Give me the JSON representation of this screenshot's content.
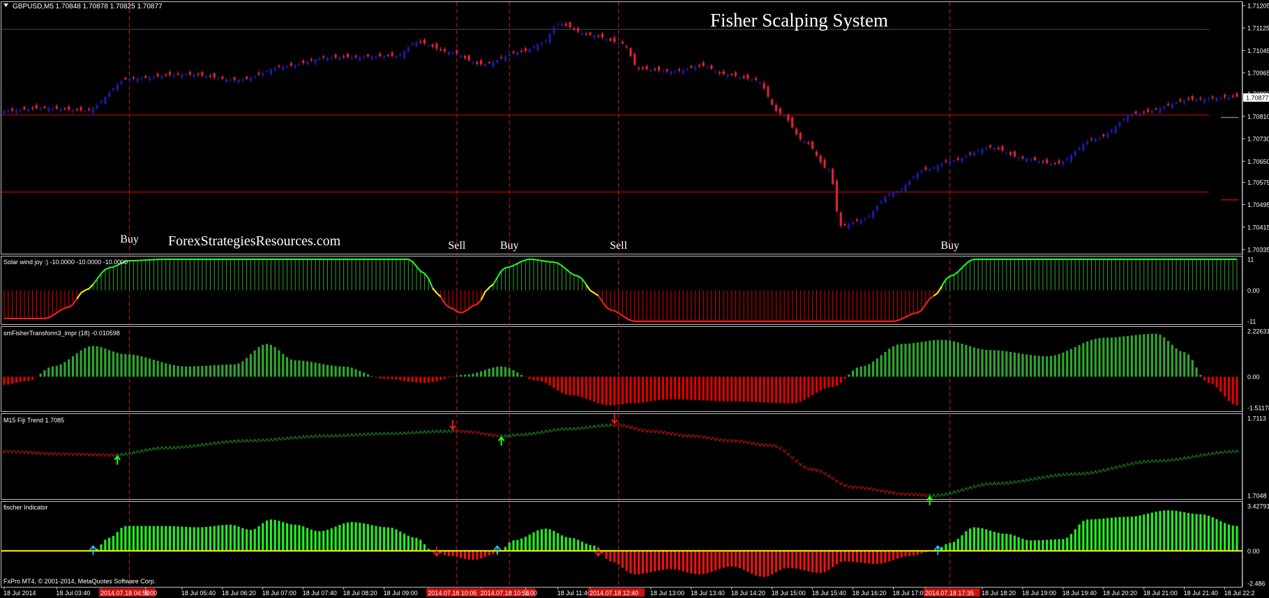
{
  "colors": {
    "bg": "#000000",
    "frame": "#c0c0c0",
    "grid": "#2a2a2a",
    "bull": "#1a1aa6",
    "bear": "#e0203a",
    "level": "#c00000",
    "vline": "#d01818",
    "green": "#2fa52f",
    "bright_green": "#22ff22",
    "red": "#e00000",
    "yellow": "#ffff00",
    "cyan": "#19d6ff",
    "text": "#ffffff"
  },
  "header": {
    "symbol_info": "GBPUSD,M5  1.70848 1.70878 1.70825 1.70877",
    "title": "Fisher Scalping System",
    "watermark": "ForexStrategiesResources.com",
    "copyright": "FxPro MT4, © 2001-2014, MetaQuotes Software Corp."
  },
  "signals": [
    {
      "label": "Buy",
      "x_index": 31
    },
    {
      "label": "Sell",
      "x_index": 112
    },
    {
      "label": "Buy",
      "x_index": 125
    },
    {
      "label": "Sell",
      "x_index": 152
    },
    {
      "label": "Buy",
      "x_index": 234
    }
  ],
  "chart_data": [
    {
      "type": "candlestick",
      "title": "GBPUSD,M5",
      "ylim": [
        1.70335,
        1.71205
      ],
      "yticks": [
        "1.71205",
        "1.71125",
        "1.71045",
        "1.70965",
        "1.70890",
        "1.70810",
        "1.70730",
        "1.70650",
        "1.70575",
        "1.70495",
        "1.70415",
        "1.70335"
      ],
      "current_price": "1.70877",
      "levels": [
        1.7112,
        1.70815,
        1.7054
      ],
      "close_anchors": [
        [
          0,
          1.7083
        ],
        [
          10,
          1.7084
        ],
        [
          20,
          1.7083
        ],
        [
          31,
          1.70945
        ],
        [
          45,
          1.7096
        ],
        [
          58,
          1.7094
        ],
        [
          70,
          1.7099
        ],
        [
          80,
          1.7102
        ],
        [
          97,
          1.71025
        ],
        [
          102,
          1.71075
        ],
        [
          110,
          1.7104
        ],
        [
          118,
          1.70995
        ],
        [
          128,
          1.7104
        ],
        [
          133,
          1.7107
        ],
        [
          137,
          1.7114
        ],
        [
          145,
          1.711
        ],
        [
          153,
          1.7107
        ],
        [
          157,
          1.7098
        ],
        [
          165,
          1.7097
        ],
        [
          173,
          1.7099
        ],
        [
          178,
          1.7096
        ],
        [
          186,
          1.7094
        ],
        [
          192,
          1.7082
        ],
        [
          198,
          1.7072
        ],
        [
          204,
          1.7062
        ],
        [
          207,
          1.7042
        ],
        [
          212,
          1.7044
        ],
        [
          220,
          1.7054
        ],
        [
          228,
          1.7062
        ],
        [
          234,
          1.7065
        ],
        [
          244,
          1.707
        ],
        [
          252,
          1.7066
        ],
        [
          260,
          1.7064
        ],
        [
          270,
          1.7073
        ],
        [
          280,
          1.7082
        ],
        [
          294,
          1.7087
        ],
        [
          305,
          1.7088
        ]
      ]
    },
    {
      "type": "bar",
      "title": "Solar wind joy :) -10.0000 -10.0000 -10.0000",
      "ylim": [
        -11,
        11
      ],
      "yticks": [
        "11",
        "0.00",
        "-11"
      ],
      "value_anchors": [
        [
          0,
          -10
        ],
        [
          10,
          -10
        ],
        [
          16,
          -6
        ],
        [
          20,
          0
        ],
        [
          26,
          8
        ],
        [
          31,
          10.5
        ],
        [
          40,
          11
        ],
        [
          100,
          11
        ],
        [
          104,
          6
        ],
        [
          107,
          -1
        ],
        [
          110,
          -6
        ],
        [
          113,
          -8
        ],
        [
          117,
          -5
        ],
        [
          120,
          1
        ],
        [
          124,
          8
        ],
        [
          130,
          11
        ],
        [
          136,
          10
        ],
        [
          142,
          5
        ],
        [
          146,
          -1
        ],
        [
          150,
          -7
        ],
        [
          156,
          -11
        ],
        [
          220,
          -11
        ],
        [
          226,
          -8
        ],
        [
          230,
          -2
        ],
        [
          234,
          5
        ],
        [
          240,
          11
        ],
        [
          305,
          11
        ]
      ]
    },
    {
      "type": "bar",
      "title": "smFisherTransform3_impr (18) -0.010598",
      "ylim": [
        -1.511784,
        2.226317
      ],
      "yticks": [
        "2.226317",
        "0.00",
        "-1.511784"
      ],
      "value_anchors": [
        [
          0,
          -0.4
        ],
        [
          6,
          -0.2
        ],
        [
          12,
          0.5
        ],
        [
          22,
          1.5
        ],
        [
          30,
          1.1
        ],
        [
          45,
          0.5
        ],
        [
          57,
          0.6
        ],
        [
          65,
          1.6
        ],
        [
          72,
          0.8
        ],
        [
          84,
          0.5
        ],
        [
          94,
          -0.1
        ],
        [
          104,
          -0.3
        ],
        [
          114,
          0.1
        ],
        [
          123,
          0.5
        ],
        [
          132,
          -0.2
        ],
        [
          140,
          -0.9
        ],
        [
          150,
          -1.4
        ],
        [
          155,
          -1.3
        ],
        [
          165,
          -1.1
        ],
        [
          180,
          -1.2
        ],
        [
          195,
          -1.3
        ],
        [
          205,
          -0.5
        ],
        [
          212,
          0.5
        ],
        [
          222,
          1.6
        ],
        [
          232,
          1.8
        ],
        [
          244,
          1.3
        ],
        [
          258,
          1.0
        ],
        [
          272,
          1.9
        ],
        [
          285,
          2.1
        ],
        [
          292,
          1.2
        ],
        [
          298,
          -0.3
        ],
        [
          305,
          -1.4
        ]
      ]
    },
    {
      "type": "line",
      "title": "M15 Fiji Trend 1.7085",
      "ylim": [
        1.7048,
        1.7113
      ],
      "yticks": [
        "1.7113",
        "1.7048"
      ],
      "value_anchors": [
        [
          0,
          1.7085
        ],
        [
          14,
          1.7083
        ],
        [
          27,
          1.7082
        ],
        [
          40,
          1.7088
        ],
        [
          60,
          1.7094
        ],
        [
          80,
          1.7098
        ],
        [
          95,
          1.71
        ],
        [
          110,
          1.7102
        ],
        [
          113,
          1.7102
        ],
        [
          124,
          1.7098
        ],
        [
          127,
          1.7099
        ],
        [
          140,
          1.7104
        ],
        [
          150,
          1.7107
        ],
        [
          152,
          1.7107
        ],
        [
          160,
          1.7102
        ],
        [
          170,
          1.7098
        ],
        [
          180,
          1.7094
        ],
        [
          190,
          1.709
        ],
        [
          200,
          1.707
        ],
        [
          210,
          1.7055
        ],
        [
          224,
          1.7049
        ],
        [
          230,
          1.7048
        ],
        [
          245,
          1.7058
        ],
        [
          265,
          1.7066
        ],
        [
          285,
          1.7077
        ],
        [
          305,
          1.7085
        ]
      ],
      "trend_change": [
        [
          0,
          "down"
        ],
        [
          28,
          "up"
        ],
        [
          112,
          "down"
        ],
        [
          123,
          "up"
        ],
        [
          151,
          "down"
        ],
        [
          229,
          "up"
        ]
      ],
      "arrows": [
        {
          "index": 28,
          "dir": "up"
        },
        {
          "index": 111,
          "dir": "down"
        },
        {
          "index": 123,
          "dir": "up"
        },
        {
          "index": 151,
          "dir": "down"
        },
        {
          "index": 229,
          "dir": "up"
        }
      ]
    },
    {
      "type": "bar",
      "title": "fischer Indicator",
      "ylim": [
        -2.486,
        3.42791
      ],
      "yticks": [
        "3.42791",
        "0.00",
        "-2.486"
      ],
      "value_anchors": [
        [
          0,
          0
        ],
        [
          22,
          0
        ],
        [
          26,
          1
        ],
        [
          30,
          1.9
        ],
        [
          40,
          1.9
        ],
        [
          48,
          1.8
        ],
        [
          56,
          2.0
        ],
        [
          61,
          1.6
        ],
        [
          66,
          2.4
        ],
        [
          72,
          2.0
        ],
        [
          78,
          1.5
        ],
        [
          86,
          2.2
        ],
        [
          95,
          1.8
        ],
        [
          102,
          1.0
        ],
        [
          106,
          0
        ],
        [
          110,
          -0.4
        ],
        [
          116,
          -0.7
        ],
        [
          122,
          -0.2
        ],
        [
          126,
          0.8
        ],
        [
          134,
          1.7
        ],
        [
          140,
          1.0
        ],
        [
          146,
          0.4
        ],
        [
          150,
          -0.8
        ],
        [
          156,
          -1.8
        ],
        [
          165,
          -1.4
        ],
        [
          172,
          -1.8
        ],
        [
          180,
          -1.2
        ],
        [
          188,
          -2.0
        ],
        [
          194,
          -1.3
        ],
        [
          202,
          -1.7
        ],
        [
          208,
          -0.8
        ],
        [
          216,
          -1.0
        ],
        [
          224,
          -0.4
        ],
        [
          230,
          0
        ],
        [
          234,
          0.6
        ],
        [
          240,
          1.8
        ],
        [
          248,
          1.3
        ],
        [
          254,
          0.8
        ],
        [
          262,
          0.9
        ],
        [
          268,
          2.4
        ],
        [
          278,
          2.6
        ],
        [
          288,
          3.1
        ],
        [
          296,
          2.8
        ],
        [
          305,
          1.9
        ]
      ],
      "arrows": [
        {
          "index": 22,
          "dir": "up"
        },
        {
          "index": 107,
          "dir": "down"
        },
        {
          "index": 122,
          "dir": "up"
        },
        {
          "index": 147,
          "dir": "down"
        },
        {
          "index": 231,
          "dir": "up"
        }
      ]
    }
  ],
  "time_axis": {
    "labels": [
      {
        "index": 0,
        "text": "18 Jul 2014"
      },
      {
        "index": 13,
        "text": "18 Jul 03:40"
      },
      {
        "index": 24,
        "text": "2014.07.18 04:50"
      },
      {
        "index": 35,
        "text": "5:00"
      },
      {
        "index": 44,
        "text": "18 Jul 05:40"
      },
      {
        "index": 54,
        "text": "18 Jul 06:20"
      },
      {
        "index": 64,
        "text": "18 Jul 07:00"
      },
      {
        "index": 74,
        "text": "18 Jul 07:40"
      },
      {
        "index": 84,
        "text": "18 Jul 08:20"
      },
      {
        "index": 94,
        "text": "18 Jul 09:00"
      },
      {
        "index": 105,
        "text": "2014.07.18 10:05"
      },
      {
        "index": 118,
        "text": "2014.07.18 10:55"
      },
      {
        "index": 129,
        "text": "1:00"
      },
      {
        "index": 137,
        "text": "18 Jul 11:40"
      },
      {
        "index": 145,
        "text": "2014.07.18 12:40"
      },
      {
        "index": 160,
        "text": "18 Jul 13:00"
      },
      {
        "index": 170,
        "text": "18 Jul 13:40"
      },
      {
        "index": 180,
        "text": "18 Jul 14:20"
      },
      {
        "index": 190,
        "text": "18 Jul 15:00"
      },
      {
        "index": 200,
        "text": "18 Jul 15:40"
      },
      {
        "index": 210,
        "text": "18 Jul 16:20"
      },
      {
        "index": 220,
        "text": "18 Jul 17:00"
      },
      {
        "index": 228,
        "text": "2014.07.18 17:35"
      },
      {
        "index": 242,
        "text": "18 Jul 18:20"
      },
      {
        "index": 252,
        "text": "18 Jul 19:00"
      },
      {
        "index": 262,
        "text": "18 Jul 19:40"
      },
      {
        "index": 272,
        "text": "18 Jul 20:20"
      },
      {
        "index": 282,
        "text": "18 Jul 21:00"
      },
      {
        "index": 292,
        "text": "18 Jul 21:40"
      },
      {
        "index": 302,
        "text": "18 Jul 22:2"
      }
    ],
    "highlighted": [
      "2014.07.18 04:50",
      "2014.07.18 10:05",
      "2014.07.18 10:55",
      "2014.07.18 12:40",
      "2014.07.18 17:35"
    ]
  }
}
